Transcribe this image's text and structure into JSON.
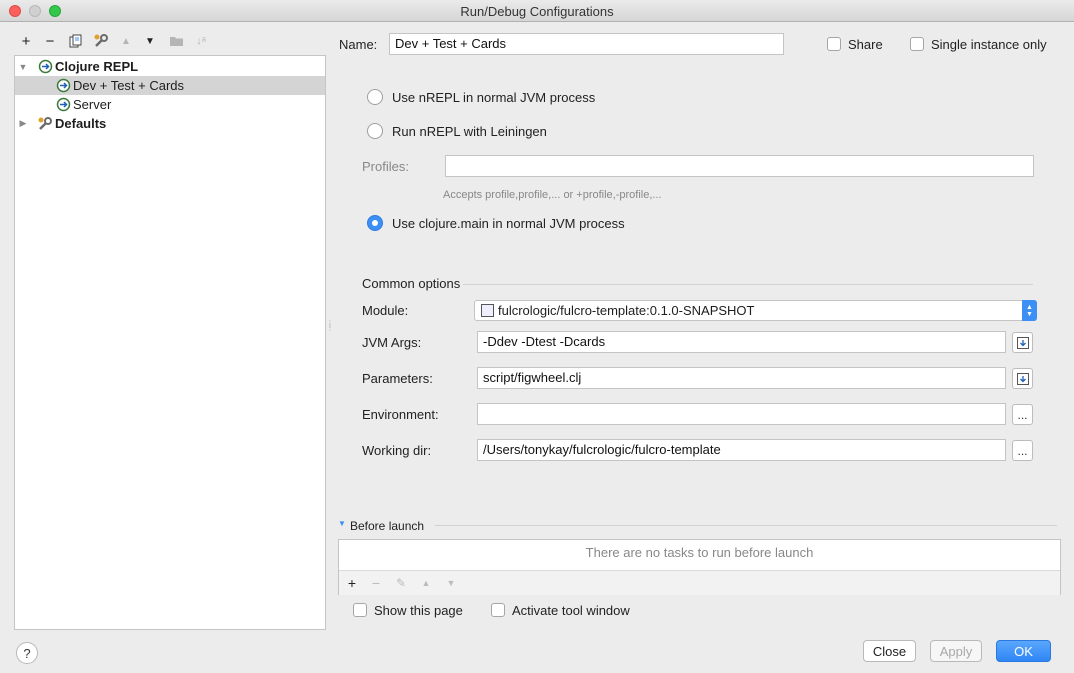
{
  "window": {
    "title": "Run/Debug Configurations"
  },
  "toolbar": {
    "add": "+",
    "remove": "−",
    "copy_icon": "copy-icon",
    "edit_defaults_icon": "wrench-icon",
    "move_up": "▲",
    "move_down": "▼",
    "folder_icon": "folder-icon",
    "sort": "↓ᵃ"
  },
  "tree": {
    "items": [
      {
        "label": "Clojure REPL",
        "icon": "clojure-repl-icon",
        "expanded": true
      },
      {
        "label": "Dev + Test + Cards",
        "icon": "run-config-icon",
        "selected": true
      },
      {
        "label": "Server",
        "icon": "run-config-icon"
      },
      {
        "label": "Defaults",
        "icon": "wrench-icon",
        "expanded": false
      }
    ]
  },
  "header": {
    "name_label": "Name:",
    "name_value": "Dev + Test + Cards",
    "share_label": "Share",
    "single_instance_label": "Single instance only"
  },
  "repl": {
    "option_nrepl_jvm": "Use nREPL in normal JVM process",
    "option_nrepl_lein": "Run nREPL with Leiningen",
    "profiles_label": "Profiles:",
    "profiles_value": "",
    "profiles_hint": "Accepts profile,profile,... or +profile,-profile,...",
    "option_clojure_main": "Use clojure.main in normal JVM process",
    "selected": "clojure_main"
  },
  "common": {
    "title": "Common options",
    "module_label": "Module:",
    "module_value": "fulcrologic/fulcro-template:0.1.0-SNAPSHOT",
    "jvm_args_label": "JVM Args:",
    "jvm_args_value": "-Ddev -Dtest -Dcards",
    "parameters_label": "Parameters:",
    "parameters_value": "script/figwheel.clj",
    "environment_label": "Environment:",
    "environment_value": "",
    "working_dir_label": "Working dir:",
    "working_dir_value": "/Users/tonykay/fulcrologic/fulcro-template",
    "browse_label": "..."
  },
  "before_launch": {
    "title": "Before launch",
    "empty_text": "There are no tasks to run before launch",
    "add": "+",
    "remove": "−",
    "edit": "✎",
    "up": "▲",
    "down": "▼"
  },
  "footer": {
    "show_page_label": "Show this page",
    "activate_tool_window_label": "Activate tool window",
    "help": "?",
    "close": "Close",
    "apply": "Apply",
    "ok": "OK"
  },
  "colors": {
    "accent": "#3b8ff5",
    "background": "#ececec",
    "selection": "#d4d4d4"
  }
}
